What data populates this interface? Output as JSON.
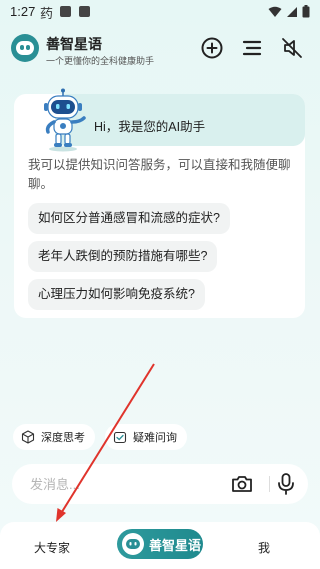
{
  "status_bar": {
    "time": "1:27",
    "carrier_glyph": "药"
  },
  "header": {
    "title": "善智星语",
    "subtitle": "一个更懂你的全科健康助手",
    "icons": [
      "add-circle-icon",
      "menu-icon",
      "mute-icon"
    ]
  },
  "chat": {
    "greeting": "Hi，我是您的AI助手",
    "intro": "我可以提供知识问答服务，可以直接和我随便聊聊。",
    "suggestions": [
      "如何区分普通感冒和流感的症状?",
      "老年人跌倒的预防措施有哪些?",
      "心理压力如何影响免疫系统?"
    ]
  },
  "chips": [
    {
      "label": "深度思考",
      "icon": "cube-icon"
    },
    {
      "label": "疑难问询",
      "icon": "check-calendar-icon"
    }
  ],
  "input": {
    "placeholder": "发消息...",
    "value": ""
  },
  "bottom_nav": {
    "left": "大专家",
    "center": "善智星语",
    "right": "我"
  },
  "colors": {
    "accent": "#2a8f95",
    "background": "#e6f7f5",
    "greeting_bubble": "#d9f0ee",
    "annotation_arrow": "#e0342c"
  }
}
